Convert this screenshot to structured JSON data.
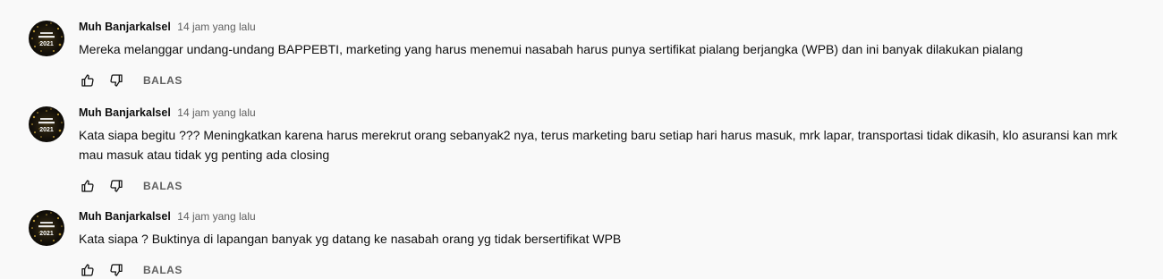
{
  "comments": [
    {
      "author": "Muh Banjarkalsel",
      "time": "14 jam yang lalu",
      "text": "Mereka melanggar undang-undang BAPPEBTI, marketing yang harus menemui nasabah harus punya sertifikat pialang berjangka (WPB) dan ini banyak dilakukan pialang",
      "reply_label": "BALAS",
      "avatar_text": "2021",
      "like_icon": "thumbs-up-icon",
      "dislike_icon": "thumbs-down-icon"
    },
    {
      "author": "Muh Banjarkalsel",
      "time": "14 jam yang lalu",
      "text": "Kata siapa begitu ??? Meningkatkan karena harus merekrut orang sebanyak2 nya, terus marketing baru setiap hari harus masuk, mrk lapar, transportasi tidak dikasih, klo asuransi kan mrk mau masuk atau tidak yg penting ada closing",
      "reply_label": "BALAS",
      "avatar_text": "2021",
      "like_icon": "thumbs-up-icon",
      "dislike_icon": "thumbs-down-icon"
    },
    {
      "author": "Muh Banjarkalsel",
      "time": "14 jam yang lalu",
      "text": "Kata siapa ? Buktinya di lapangan banyak yg datang ke nasabah orang yg tidak bersertifikat WPB",
      "reply_label": "BALAS",
      "avatar_text": "2021",
      "like_icon": "thumbs-up-icon",
      "dislike_icon": "thumbs-down-icon"
    }
  ],
  "colors": {
    "background": "#f9f9f9",
    "text": "#0f0f0f",
    "secondary": "#606060",
    "avatar_gold": "#c9a43a"
  }
}
